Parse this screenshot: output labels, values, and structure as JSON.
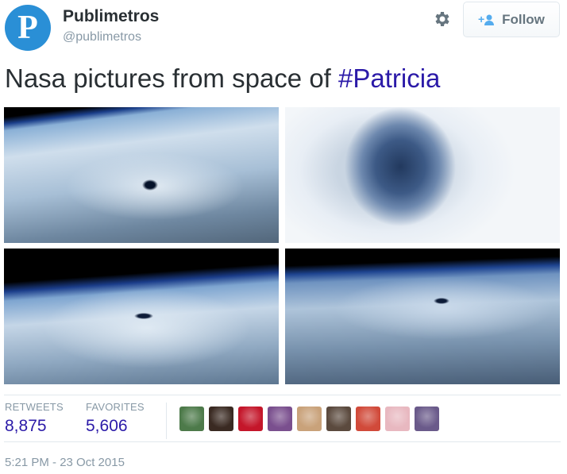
{
  "account": {
    "avatar_letter": "P",
    "display_name": "Publimetros",
    "handle": "@publimetros"
  },
  "actions": {
    "follow_label": "Follow"
  },
  "tweet": {
    "text": "Nasa pictures from space of ",
    "hashtag": "#Patricia",
    "timestamp": "5:21 PM - 23 Oct 2015"
  },
  "stats": {
    "retweets_label": "RETWEETS",
    "retweets_count": "8,875",
    "favorites_label": "FAVORITES",
    "favorites_count": "5,606"
  },
  "favoriters": [
    {
      "icon": "user-avatar",
      "color": "#4d7a4a"
    },
    {
      "icon": "user-avatar",
      "color": "#3a2a22"
    },
    {
      "icon": "user-avatar",
      "color": "#c4162a"
    },
    {
      "icon": "user-avatar",
      "color": "#7a4f8e"
    },
    {
      "icon": "user-avatar",
      "color": "#c9a27a"
    },
    {
      "icon": "user-avatar",
      "color": "#5b4a3e"
    },
    {
      "icon": "user-avatar",
      "color": "#d14a3a"
    },
    {
      "icon": "user-avatar",
      "color": "#e8b8c0"
    },
    {
      "icon": "user-avatar",
      "color": "#6a5a8a"
    }
  ],
  "colors": {
    "link": "#2b1aa8",
    "muted": "#8899a6",
    "follow_icon": "#55acee"
  }
}
